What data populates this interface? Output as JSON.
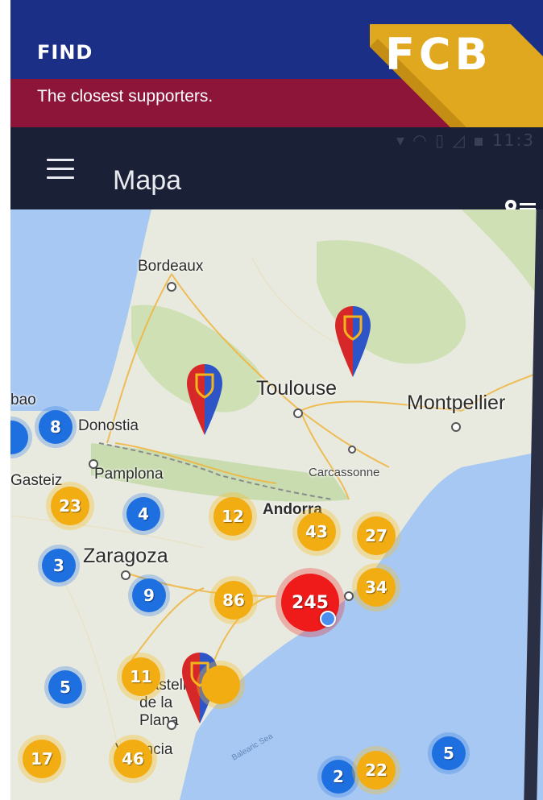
{
  "promo": {
    "title": "FIND",
    "subtitle": "The closest supporters.",
    "badge": "FCB",
    "colors": {
      "top": "#1b2f86",
      "bottom": "#8d1539",
      "badge": "#e0a81f"
    }
  },
  "app": {
    "status_time": "11:3",
    "title": "Mapa",
    "menu_icon": "hamburger-menu-icon",
    "action_icon": "map-list-icon"
  },
  "map": {
    "labels": {
      "bordeaux": "Bordeaux",
      "toulouse": "Toulouse",
      "montpellier": "Montpellier",
      "donostia": "Donostia",
      "pamplona": "Pamplona",
      "carcassonne": "Carcassonne",
      "andorra": "Andorra",
      "zaragoza": "Zaragoza",
      "castellon": "Castellón de la Plana",
      "valencia": "Valencia",
      "bao": "bao",
      "gasteiz": "Gasteiz",
      "balearic_sea": "Balearic Sea"
    },
    "clusters": [
      {
        "id": "c8",
        "count": "8",
        "kind": "blue"
      },
      {
        "id": "c23",
        "count": "23",
        "kind": "yellow"
      },
      {
        "id": "c4",
        "count": "4",
        "kind": "blue"
      },
      {
        "id": "c12",
        "count": "12",
        "kind": "yellow"
      },
      {
        "id": "c43",
        "count": "43",
        "kind": "yellow"
      },
      {
        "id": "c27",
        "count": "27",
        "kind": "yellow"
      },
      {
        "id": "c3",
        "count": "3",
        "kind": "blue"
      },
      {
        "id": "c9",
        "count": "9",
        "kind": "blue"
      },
      {
        "id": "c86",
        "count": "86",
        "kind": "yellow"
      },
      {
        "id": "c245",
        "count": "245",
        "kind": "red"
      },
      {
        "id": "c34",
        "count": "34",
        "kind": "yellow"
      },
      {
        "id": "c5a",
        "count": "5",
        "kind": "blue"
      },
      {
        "id": "c11",
        "count": "11",
        "kind": "yellow"
      },
      {
        "id": "c17",
        "count": "17",
        "kind": "yellow"
      },
      {
        "id": "c46",
        "count": "46",
        "kind": "yellow"
      },
      {
        "id": "c2",
        "count": "2",
        "kind": "blue"
      },
      {
        "id": "c22",
        "count": "22",
        "kind": "yellow"
      },
      {
        "id": "c5b",
        "count": "5",
        "kind": "blue"
      }
    ],
    "pins": [
      "fcb-pin-icon",
      "fcb-pin-icon",
      "fcb-pin-icon"
    ]
  }
}
